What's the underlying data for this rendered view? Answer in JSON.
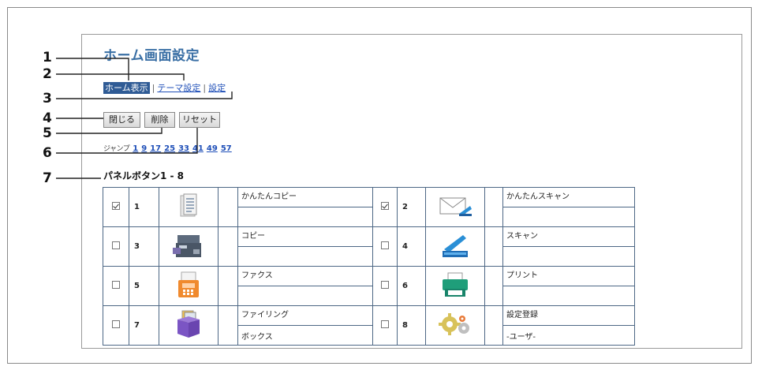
{
  "page": {
    "title": "ホーム画面設定",
    "tabs": {
      "home": "ホーム表示",
      "theme": "テーマ設定",
      "settings": "設定",
      "sep": "|"
    },
    "buttons": {
      "close": "閉じる",
      "delete": "削除",
      "reset": "リセット"
    },
    "jump": {
      "label": "ジャンプ",
      "pages": [
        "1",
        "9",
        "17",
        "25",
        "33",
        "41",
        "49",
        "57"
      ]
    },
    "section_title": "パネルボタン1 - 8"
  },
  "panel_buttons": [
    {
      "index": "1",
      "checked": true,
      "icon": "copy-icon",
      "name_line1": "かんたんコピー",
      "name_line2": ""
    },
    {
      "index": "2",
      "checked": true,
      "icon": "scan-mail-icon",
      "name_line1": "かんたんスキャン",
      "name_line2": ""
    },
    {
      "index": "3",
      "checked": false,
      "icon": "copier-icon",
      "name_line1": "コピー",
      "name_line2": ""
    },
    {
      "index": "4",
      "checked": false,
      "icon": "scanner-icon",
      "name_line1": "スキャン",
      "name_line2": ""
    },
    {
      "index": "5",
      "checked": false,
      "icon": "fax-icon",
      "name_line1": "ファクス",
      "name_line2": ""
    },
    {
      "index": "6",
      "checked": false,
      "icon": "printer-icon",
      "name_line1": "プリント",
      "name_line2": ""
    },
    {
      "index": "7",
      "checked": false,
      "icon": "filing-box-icon",
      "name_line1": "ファイリング",
      "name_line2": "ボックス"
    },
    {
      "index": "8",
      "checked": false,
      "icon": "gears-icon",
      "name_line1": "設定登録",
      "name_line2": "-ユーザ-"
    }
  ],
  "callouts": [
    "1",
    "2",
    "3",
    "4",
    "5",
    "6",
    "7"
  ],
  "colors": {
    "title": "#3a6fa5",
    "active_tab": "#2f5b95",
    "link": "#1f4fb8",
    "table_border": "#4d6785"
  }
}
